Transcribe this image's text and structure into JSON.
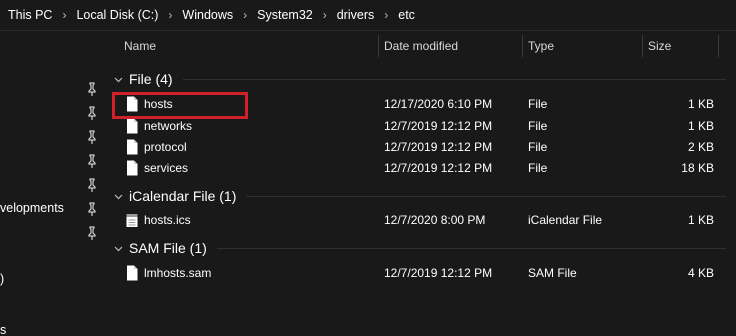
{
  "breadcrumb": [
    "This PC",
    "Local Disk (C:)",
    "Windows",
    "System32",
    "drivers",
    "etc"
  ],
  "nav": {
    "partial_labels": [
      "velopments",
      ")",
      "s"
    ]
  },
  "columns": {
    "name": "Name",
    "date": "Date modified",
    "type": "Type",
    "size": "Size"
  },
  "groups": [
    {
      "label": "File (4)",
      "files": [
        {
          "name": "hosts",
          "date": "12/17/2020 6:10 PM",
          "type": "File",
          "size": "1 KB",
          "icon": "file-icon",
          "highlighted": true
        },
        {
          "name": "networks",
          "date": "12/7/2019 12:12 PM",
          "type": "File",
          "size": "1 KB",
          "icon": "file-icon"
        },
        {
          "name": "protocol",
          "date": "12/7/2019 12:12 PM",
          "type": "File",
          "size": "2 KB",
          "icon": "file-icon"
        },
        {
          "name": "services",
          "date": "12/7/2019 12:12 PM",
          "type": "File",
          "size": "18 KB",
          "icon": "file-icon"
        }
      ]
    },
    {
      "label": "iCalendar File (1)",
      "files": [
        {
          "name": "hosts.ics",
          "date": "12/7/2020 8:00 PM",
          "type": "iCalendar File",
          "size": "1 KB",
          "icon": "calendar-file-icon"
        }
      ]
    },
    {
      "label": "SAM File (1)",
      "files": [
        {
          "name": "lmhosts.sam",
          "date": "12/7/2019 12:12 PM",
          "type": "SAM File",
          "size": "4 KB",
          "icon": "file-icon"
        }
      ]
    }
  ],
  "colors": {
    "background": "#191919",
    "highlight_border": "#d0212b",
    "text": "#ffffff"
  }
}
